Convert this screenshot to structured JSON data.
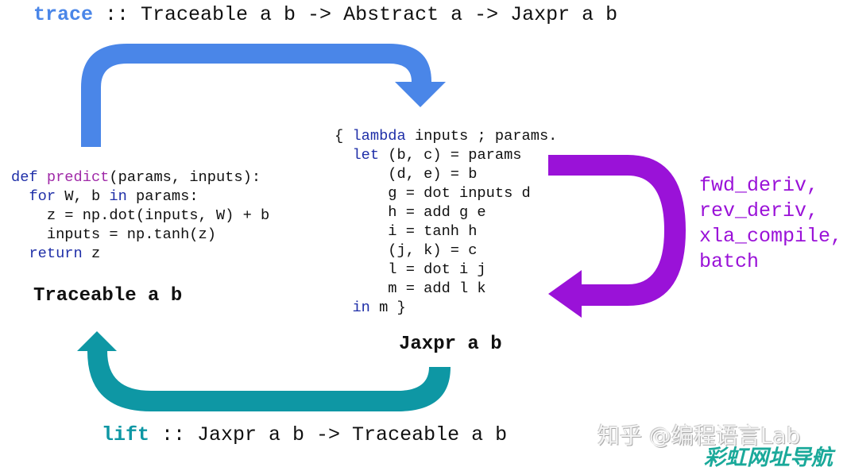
{
  "colors": {
    "trace": "#4a86e8",
    "transform": "#9a12d8",
    "lift": "#0e97a4",
    "keyword": "#1f2fa8",
    "function": "#a02aa8"
  },
  "trace_signature": {
    "name": "trace",
    "rest": " :: Traceable a b -> Abstract a -> Jaxpr a b"
  },
  "lift_signature": {
    "name": "lift",
    "rest": " :: Jaxpr a b -> Traceable a b"
  },
  "python_code": {
    "line1": {
      "kw": "def",
      "sp": " ",
      "fn": "predict",
      "rest": "(params, inputs):"
    },
    "line2": {
      "indent": "  ",
      "kw": "for",
      "mid": " W, b ",
      "kw2": "in",
      "rest": " params:"
    },
    "line3": "    z = np.dot(inputs, W) + b",
    "line4": "    inputs = np.tanh(z)",
    "line5": {
      "indent": "  ",
      "kw": "return",
      "rest": " z"
    }
  },
  "jaxpr_code": {
    "line1": {
      "pre": "{ ",
      "kw": "lambda",
      "rest": " inputs ; params."
    },
    "line2": {
      "indent": "  ",
      "kw": "let",
      "rest": " (b, c) = params"
    },
    "lines": [
      "      (d, e) = b",
      "      g = dot inputs d",
      "      h = add g e",
      "      i = tanh h",
      "      (j, k) = c",
      "      l = dot i j",
      "      m = add l k"
    ],
    "last": {
      "indent": "  ",
      "kw": "in",
      "rest": " m }"
    }
  },
  "labels": {
    "traceable": "Traceable a b",
    "jaxpr": "Jaxpr a b"
  },
  "transformations": [
    "fwd_deriv,",
    "rev_deriv,",
    "xla_compile,",
    "batch"
  ],
  "watermarks": {
    "zhihu": "知乎 @编程语言Lab",
    "site": "彩虹网址导航"
  }
}
